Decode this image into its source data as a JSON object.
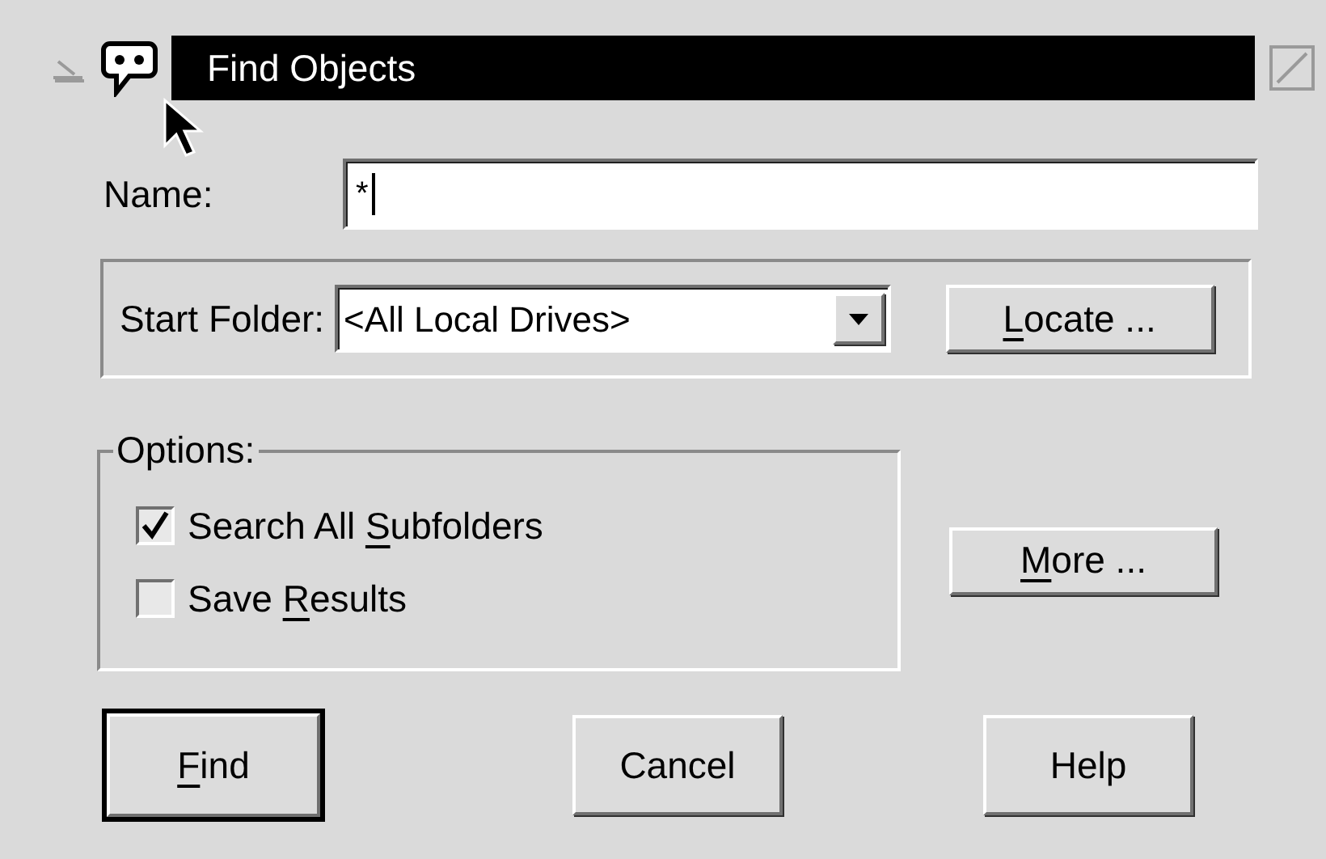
{
  "window": {
    "title": "Find Objects"
  },
  "name_field": {
    "label": "Name:",
    "value": "*"
  },
  "start_folder": {
    "label": "Start Folder:",
    "value": "<All Local Drives>"
  },
  "locate_button": {
    "label": [
      {
        "text": "L",
        "underline": true
      },
      {
        "text": "ocate ...",
        "underline": false
      }
    ]
  },
  "options": {
    "title": "Options:",
    "items": [
      {
        "label": [
          {
            "text": "Search All ",
            "underline": false
          },
          {
            "text": "S",
            "underline": true
          },
          {
            "text": "ubfolders",
            "underline": false
          }
        ],
        "checked": true
      },
      {
        "label": [
          {
            "text": "Save ",
            "underline": false
          },
          {
            "text": "R",
            "underline": true
          },
          {
            "text": "esults",
            "underline": false
          }
        ],
        "checked": false
      }
    ]
  },
  "more_button": {
    "label": [
      {
        "text": "M",
        "underline": true
      },
      {
        "text": "ore ...",
        "underline": false
      }
    ]
  },
  "buttons": [
    {
      "label": [
        {
          "text": "F",
          "underline": true
        },
        {
          "text": "ind",
          "underline": false
        }
      ],
      "default": true
    },
    {
      "label": [
        {
          "text": "Cancel",
          "underline": false
        }
      ],
      "default": false
    },
    {
      "label": [
        {
          "text": "Help",
          "underline": false
        }
      ],
      "default": false
    }
  ]
}
